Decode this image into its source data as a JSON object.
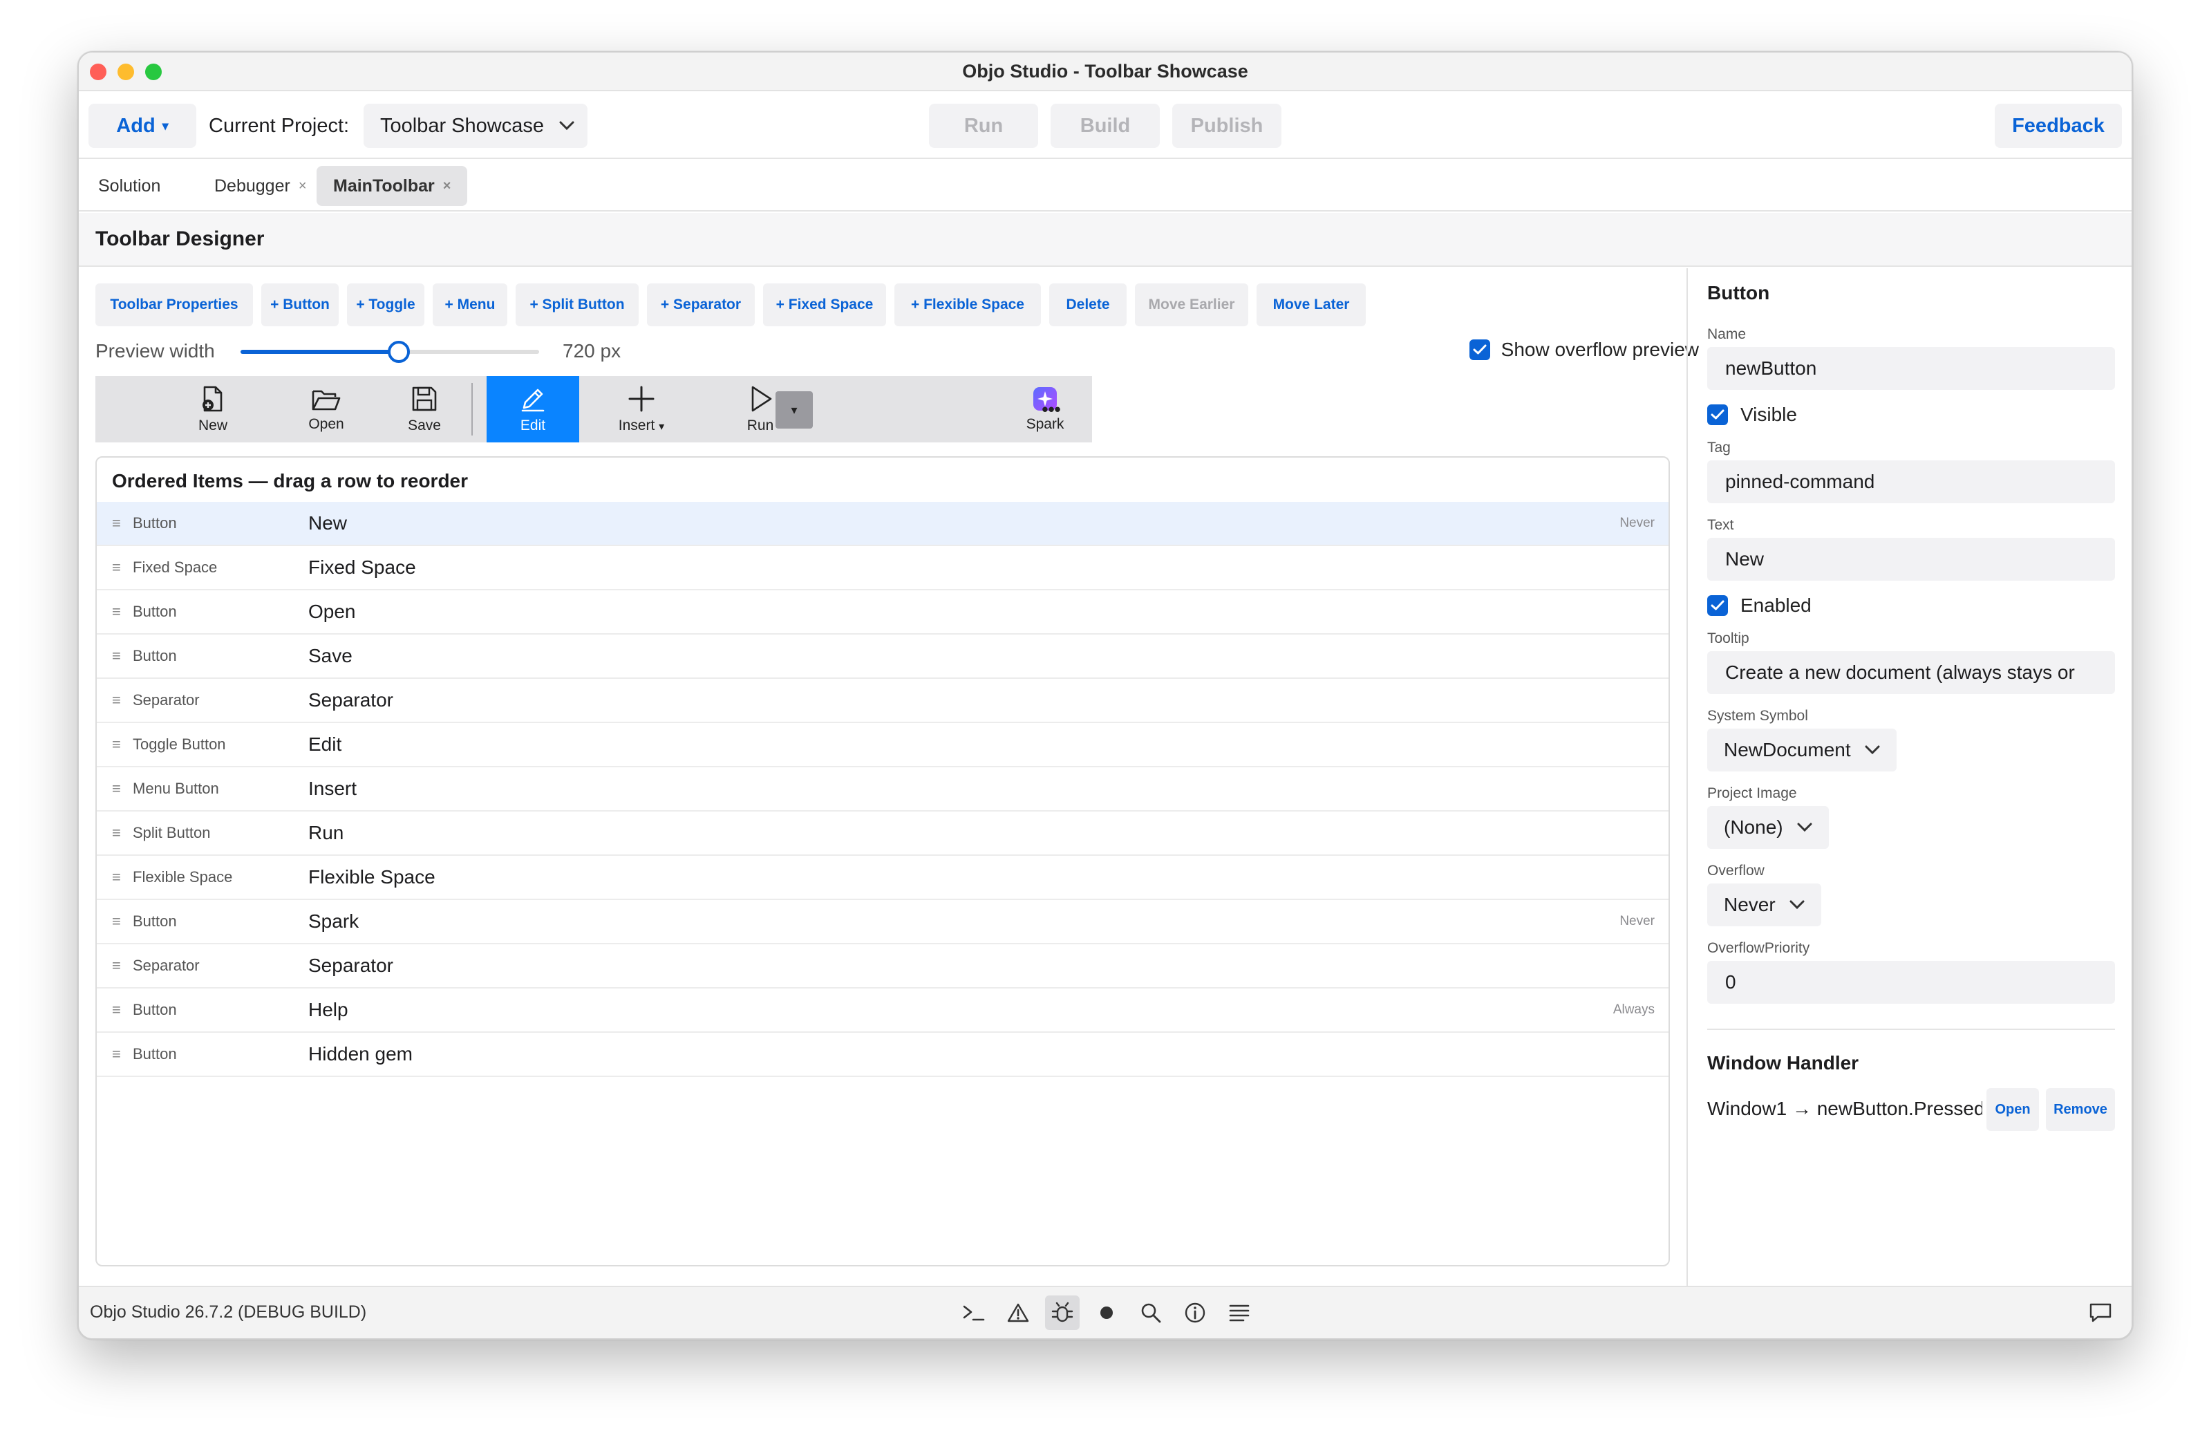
{
  "window": {
    "title": "Objo Studio - Toolbar Showcase",
    "traffic_colors": [
      "#ff5f57",
      "#febc2e",
      "#28c840"
    ]
  },
  "toolbar": {
    "add_label": "Add",
    "add_caret": "▾",
    "current_project_label": "Current Project:",
    "project_value": "Toolbar Showcase",
    "run_label": "Run",
    "build_label": "Build",
    "publish_label": "Publish",
    "feedback_label": "Feedback"
  },
  "tabs": [
    {
      "label": "Solution",
      "closable": false
    },
    {
      "label": "Debugger",
      "closable": true,
      "close": "×"
    },
    {
      "label": "MainToolbar",
      "closable": true,
      "close": "×",
      "active": true
    }
  ],
  "designer": {
    "title": "Toolbar Designer",
    "actions": [
      {
        "label": "Toolbar Properties",
        "enabled": true
      },
      {
        "label": "+ Button",
        "enabled": true
      },
      {
        "label": "+ Toggle",
        "enabled": true
      },
      {
        "label": "+ Menu",
        "enabled": true
      },
      {
        "label": "+ Split Button",
        "enabled": true
      },
      {
        "label": "+ Separator",
        "enabled": true
      },
      {
        "label": "+ Fixed Space",
        "enabled": true
      },
      {
        "label": "+ Flexible Space",
        "enabled": true
      },
      {
        "label": "Delete",
        "enabled": true
      },
      {
        "label": "Move Earlier",
        "enabled": false
      },
      {
        "label": "Move Later",
        "enabled": true
      }
    ],
    "preview_width_label": "Preview width",
    "preview_width_value": "720 px",
    "slider_fraction": 0.53,
    "show_overflow_label": "Show overflow preview",
    "show_overflow_checked": true,
    "preview_items": [
      {
        "label": "New",
        "icon": "new-document-icon"
      },
      {
        "label": "Open",
        "icon": "folder-open-icon"
      },
      {
        "label": "Save",
        "icon": "save-icon"
      },
      {
        "label": "Edit",
        "icon": "pencil-icon",
        "active": true
      },
      {
        "label": "Insert",
        "icon": "plus-icon",
        "caret": "▾"
      },
      {
        "label": "Run",
        "icon": "play-icon"
      },
      {
        "label": "Spark",
        "icon": "spark-icon"
      }
    ],
    "split_dropdown_caret": "▾",
    "overflow_more": "•••",
    "accent_color": "#0a84ff"
  },
  "ordered_items": {
    "title": "Ordered Items — drag a row to reorder",
    "handle": "≡",
    "rows": [
      {
        "kind": "Button",
        "label": "New",
        "overflow": "Never",
        "selected": true
      },
      {
        "kind": "Fixed Space",
        "label": "Fixed Space",
        "overflow": ""
      },
      {
        "kind": "Button",
        "label": "Open",
        "overflow": ""
      },
      {
        "kind": "Button",
        "label": "Save",
        "overflow": ""
      },
      {
        "kind": "Separator",
        "label": "Separator",
        "overflow": ""
      },
      {
        "kind": "Toggle Button",
        "label": "Edit",
        "overflow": ""
      },
      {
        "kind": "Menu Button",
        "label": "Insert",
        "overflow": ""
      },
      {
        "kind": "Split Button",
        "label": "Run",
        "overflow": ""
      },
      {
        "kind": "Flexible Space",
        "label": "Flexible Space",
        "overflow": ""
      },
      {
        "kind": "Button",
        "label": "Spark",
        "overflow": "Never"
      },
      {
        "kind": "Separator",
        "label": "Separator",
        "overflow": ""
      },
      {
        "kind": "Button",
        "label": "Help",
        "overflow": "Always"
      },
      {
        "kind": "Button",
        "label": "Hidden gem",
        "overflow": ""
      }
    ]
  },
  "inspector": {
    "title": "Button",
    "name_label": "Name",
    "name_value": "newButton",
    "visible_label": "Visible",
    "visible_checked": true,
    "tag_label": "Tag",
    "tag_value": "pinned-command",
    "text_label": "Text",
    "text_value": "New",
    "enabled_label": "Enabled",
    "enabled_checked": true,
    "tooltip_label": "Tooltip",
    "tooltip_value": "Create a new document (always stays or",
    "system_symbol_label": "System Symbol",
    "system_symbol_value": "NewDocument",
    "project_image_label": "Project Image",
    "project_image_value": "(None)",
    "overflow_label": "Overflow",
    "overflow_value": "Never",
    "overflow_priority_label": "OverflowPriority",
    "overflow_priority_value": "0",
    "window_handler_title": "Window Handler",
    "window_handler_text": "Window1 → newButton.Pressed",
    "open_label": "Open",
    "remove_label": "Remove"
  },
  "statusbar": {
    "version_text": "Objo Studio 26.7.2 (DEBUG BUILD)",
    "icons": [
      "terminal-icon",
      "warning-icon",
      "bug-icon",
      "record-icon",
      "search-icon",
      "info-icon",
      "list-icon"
    ],
    "active_icon": "bug-icon",
    "chat_icon": "chat-bubble-icon"
  }
}
